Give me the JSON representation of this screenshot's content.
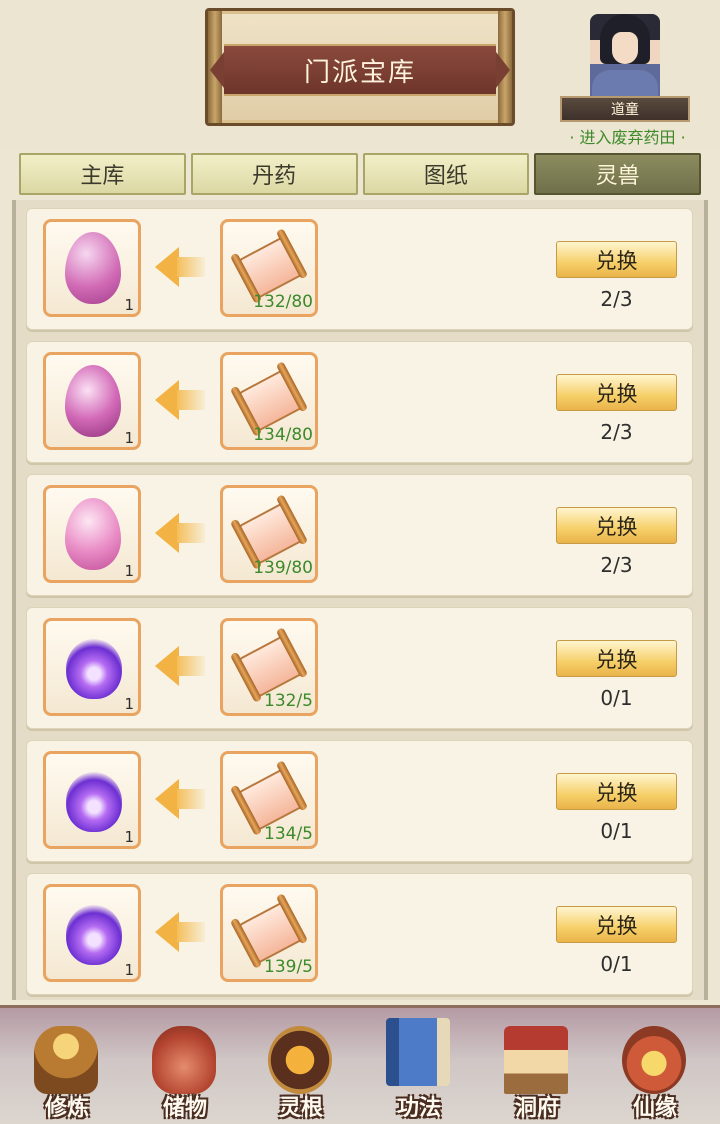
{
  "header": {
    "title": "门派宝库",
    "rank": "道童",
    "abandon_link": "· 进入废弃药田 ·"
  },
  "tabs": [
    {
      "label": "主库",
      "active": false
    },
    {
      "label": "丹药",
      "active": false
    },
    {
      "label": "图纸",
      "active": false
    },
    {
      "label": "灵兽",
      "active": true
    }
  ],
  "items": [
    {
      "reward_icon": "pink-beast-egg-icon",
      "reward_count": "1",
      "cost_icon": "scroll-icon",
      "cost_progress": "132/80",
      "button": "兑换",
      "limit": "2/3"
    },
    {
      "reward_icon": "pink-beast-egg-icon",
      "reward_count": "1",
      "cost_icon": "scroll-icon",
      "cost_progress": "134/80",
      "button": "兑换",
      "limit": "2/3"
    },
    {
      "reward_icon": "pink-beast-egg-icon",
      "reward_count": "1",
      "cost_icon": "scroll-icon",
      "cost_progress": "139/80",
      "button": "兑换",
      "limit": "2/3"
    },
    {
      "reward_icon": "purple-spirit-flame-icon",
      "reward_count": "1",
      "cost_icon": "scroll-icon",
      "cost_progress": "132/5",
      "button": "兑换",
      "limit": "0/1"
    },
    {
      "reward_icon": "purple-spirit-flame-icon",
      "reward_count": "1",
      "cost_icon": "scroll-icon",
      "cost_progress": "134/5",
      "button": "兑换",
      "limit": "0/1"
    },
    {
      "reward_icon": "purple-spirit-flame-icon",
      "reward_count": "1",
      "cost_icon": "scroll-icon",
      "cost_progress": "139/5",
      "button": "兑换",
      "limit": "0/1"
    }
  ],
  "bottom_nav": [
    {
      "label": "修炼",
      "icon": "cultivate-icon"
    },
    {
      "label": "储物",
      "icon": "storage-bag-icon"
    },
    {
      "label": "灵根",
      "icon": "spirit-root-icon"
    },
    {
      "label": "功法",
      "icon": "method-book-icon",
      "active": true
    },
    {
      "label": "洞府",
      "icon": "cave-abode-icon"
    },
    {
      "label": "仙缘",
      "icon": "fate-gourd-icon"
    }
  ],
  "colors": {
    "background": "#ece6d3",
    "tab_active": "#7d7d55",
    "slot_border": "#e8a460",
    "progress_green": "#3c8a2c",
    "button_gold": "#f6cf68"
  }
}
